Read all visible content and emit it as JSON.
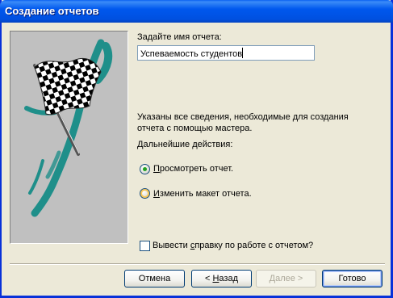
{
  "window": {
    "title": "Создание отчетов"
  },
  "art": {
    "icon": "checkered-flag-icon",
    "accent": "#1f8f8a"
  },
  "form": {
    "name_label": "Задайте имя отчета:",
    "name_value": "Успеваемость студентов"
  },
  "info": {
    "line1": "Указаны все сведения, необходимые для создания",
    "line2": "отчета с помощью мастера.",
    "next_label": "Дальнейшие действия:"
  },
  "options": [
    {
      "label_u": "П",
      "label_rest": "росмотреть отчет.",
      "selected": true
    },
    {
      "label_u": "И",
      "label_rest": "зменить макет отчета.",
      "selected": false
    }
  ],
  "help_checkbox": {
    "pre": "Вывести ",
    "u": "с",
    "post": "правку по работе с отчетом?",
    "checked": false
  },
  "buttons": {
    "cancel": "Отмена",
    "back_pre": "< ",
    "back_u": "Н",
    "back_post": "азад",
    "next": "Далее >",
    "finish": "Готово"
  }
}
